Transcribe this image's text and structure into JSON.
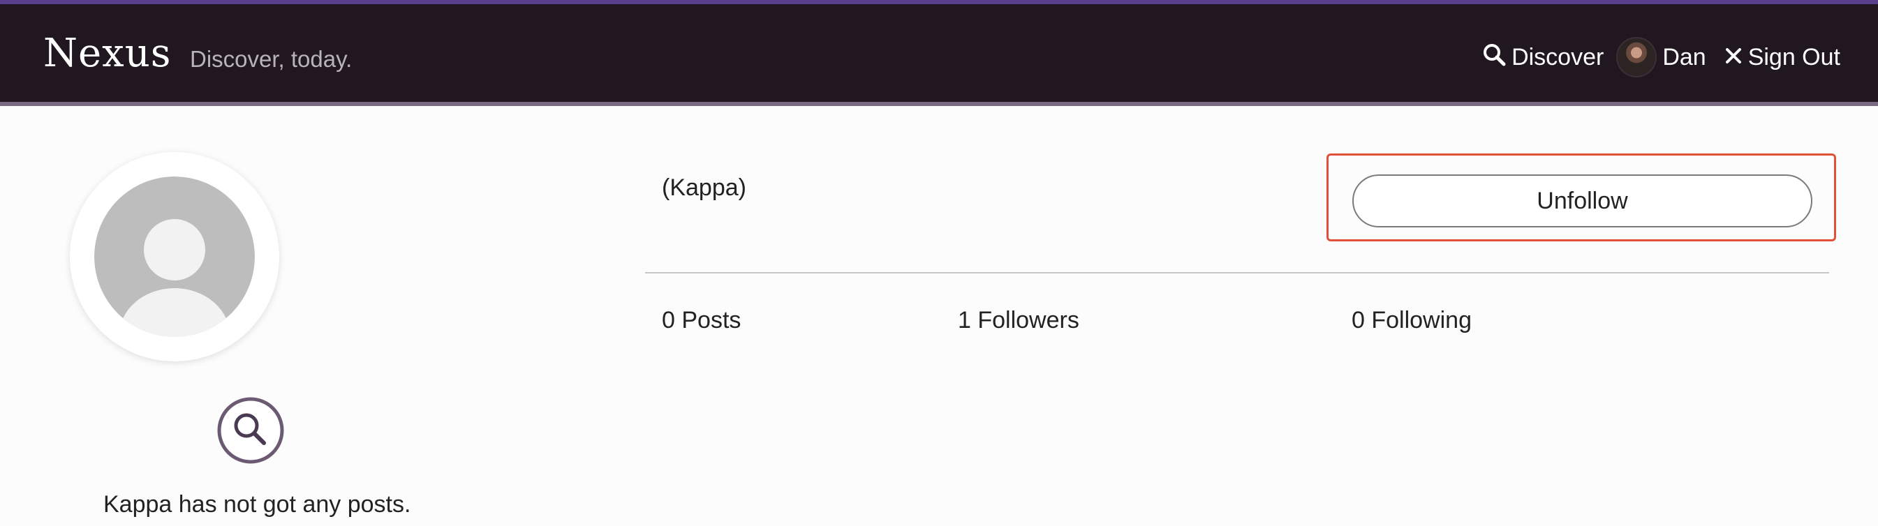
{
  "header": {
    "brand": "Nexus",
    "tagline": "Discover, today.",
    "nav": {
      "discover_label": "Discover",
      "user_name": "Dan",
      "sign_out_label": "Sign Out"
    }
  },
  "profile": {
    "username": "(Kappa)",
    "unfollow_label": "Unfollow",
    "stats": {
      "posts": "0 Posts",
      "followers": "1 Followers",
      "following": "0 Following"
    },
    "empty_message": "Kappa has not got any posts."
  },
  "icons": {
    "discover": "search-icon",
    "sign_out": "close-icon",
    "empty_posts": "search-circle-icon",
    "profile_avatar": "default-user-avatar-icon"
  },
  "colors": {
    "header_bg": "#211721",
    "header_top_accent": "#5a3f8f",
    "highlight_border": "#e0503a"
  }
}
